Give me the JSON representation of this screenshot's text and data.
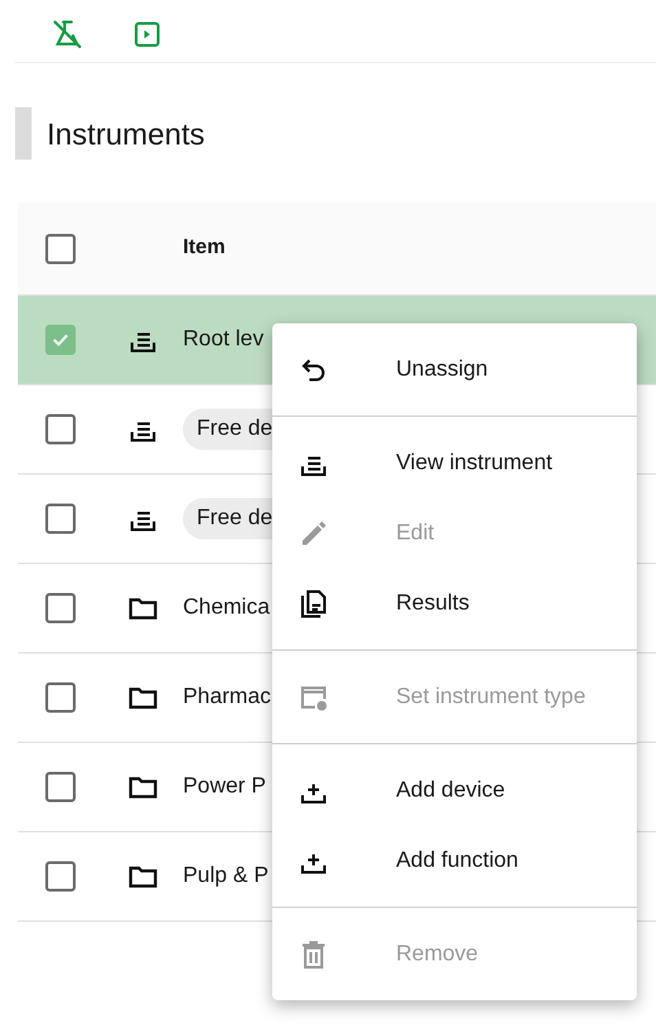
{
  "toolbar": {
    "buttons": [
      {
        "kind": "flask"
      },
      {
        "kind": "play"
      }
    ]
  },
  "section": {
    "title": "Instruments"
  },
  "table": {
    "header": {
      "checked": false,
      "label": "Item"
    },
    "rows": [
      {
        "kind": "instrument",
        "label": "Root lev",
        "checked": true,
        "selected": true,
        "chip": false
      },
      {
        "kind": "instrument",
        "label": "Free de",
        "checked": false,
        "selected": false,
        "chip": true
      },
      {
        "kind": "instrument",
        "label": "Free de",
        "checked": false,
        "selected": false,
        "chip": true
      },
      {
        "kind": "folder",
        "label": "Chemica",
        "checked": false,
        "selected": false,
        "chip": false
      },
      {
        "kind": "folder",
        "label": "Pharmac",
        "checked": false,
        "selected": false,
        "chip": false
      },
      {
        "kind": "folder",
        "label": "Power P",
        "checked": false,
        "selected": false,
        "chip": false
      },
      {
        "kind": "folder",
        "label": "Pulp & P",
        "checked": false,
        "selected": false,
        "chip": false
      }
    ]
  },
  "context_menu": {
    "groups": [
      [
        {
          "kind": "unassign",
          "label": "Unassign",
          "disabled": false
        }
      ],
      [
        {
          "kind": "view",
          "label": "View instrument",
          "disabled": false
        },
        {
          "kind": "edit",
          "label": "Edit",
          "disabled": true
        },
        {
          "kind": "results",
          "label": "Results",
          "disabled": false
        }
      ],
      [
        {
          "kind": "type",
          "label": "Set instrument type",
          "disabled": true
        }
      ],
      [
        {
          "kind": "add",
          "label": "Add device",
          "disabled": false
        },
        {
          "kind": "add",
          "label": "Add function",
          "disabled": false
        }
      ],
      [
        {
          "kind": "remove",
          "label": "Remove",
          "disabled": true
        }
      ]
    ]
  }
}
